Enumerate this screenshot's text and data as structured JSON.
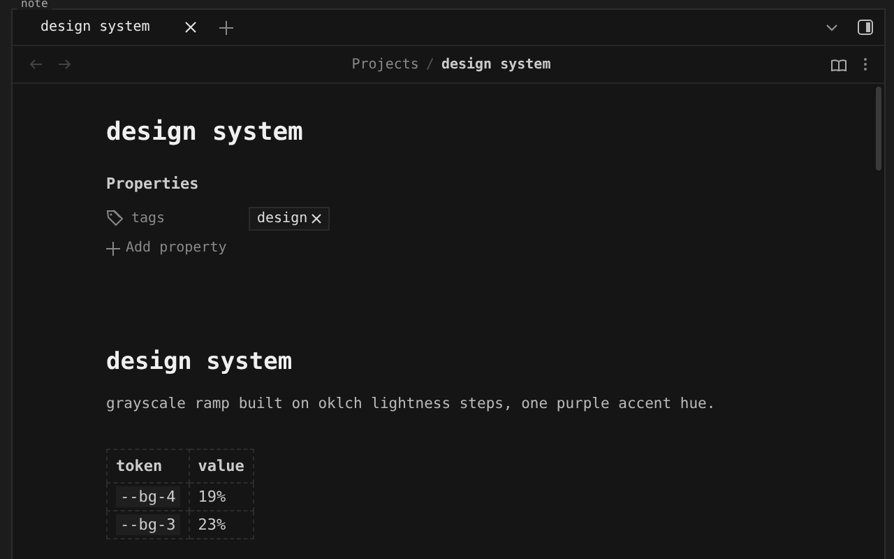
{
  "frame_label": "note",
  "tabs": [
    {
      "label": "design system",
      "selected": true
    }
  ],
  "breadcrumb": [
    "Projects",
    "design system"
  ],
  "breadcrumb_separator": "/",
  "title": "design system",
  "properties": {
    "heading": "Properties",
    "items": [
      {
        "name": "tags",
        "values": [
          "design"
        ]
      }
    ],
    "add_label": "Add property"
  },
  "body": {
    "heading": "design system",
    "paragraph": "grayscale ramp built on oklch lightness steps, one purple accent hue.",
    "table": {
      "columns": [
        "token",
        "value"
      ],
      "rows": [
        [
          "--bg-4",
          "19%"
        ],
        [
          "--bg-3",
          "23%"
        ]
      ]
    }
  }
}
